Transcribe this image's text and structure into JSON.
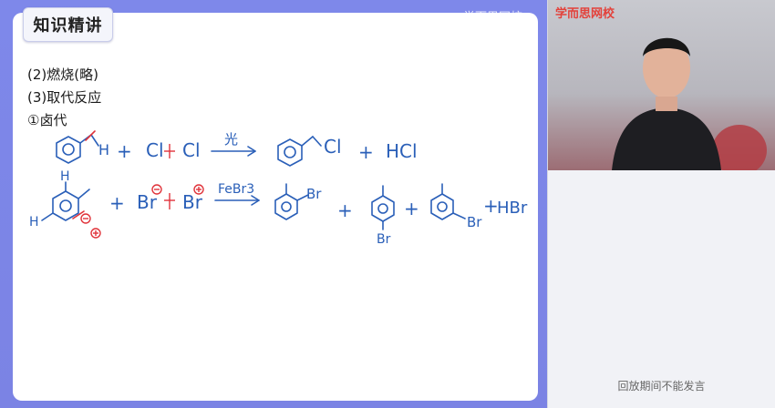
{
  "lesson": {
    "section_title": "知识精讲",
    "watermark": "学而思网校",
    "lines": [
      "(2)燃烧(略)",
      "(3)取代反应",
      "①卤代"
    ]
  },
  "equations": {
    "row1": {
      "h": "H",
      "plus1": "+",
      "cl1": "Cl",
      "cl2": "Cl",
      "condition": "光",
      "product_cl": "Cl",
      "plus2": "+",
      "hcl": "HCl"
    },
    "row2": {
      "h_top": "H",
      "h_left": "H",
      "plus1": "+",
      "br1": "Br",
      "br2": "Br",
      "catalyst": "FeBr3",
      "p1_br": "Br",
      "plus2": "+",
      "p2_br": "Br",
      "plus3": "+",
      "p3_br": "Br",
      "plus4": "+",
      "hbr": "HBr"
    }
  },
  "video": {
    "brand": "学而思网校"
  },
  "side": {
    "notice": "回放期间不能发言"
  },
  "colors": {
    "ink": "#2a5fb8",
    "red_mark": "#e0333a",
    "stage": "#7e88ea"
  }
}
